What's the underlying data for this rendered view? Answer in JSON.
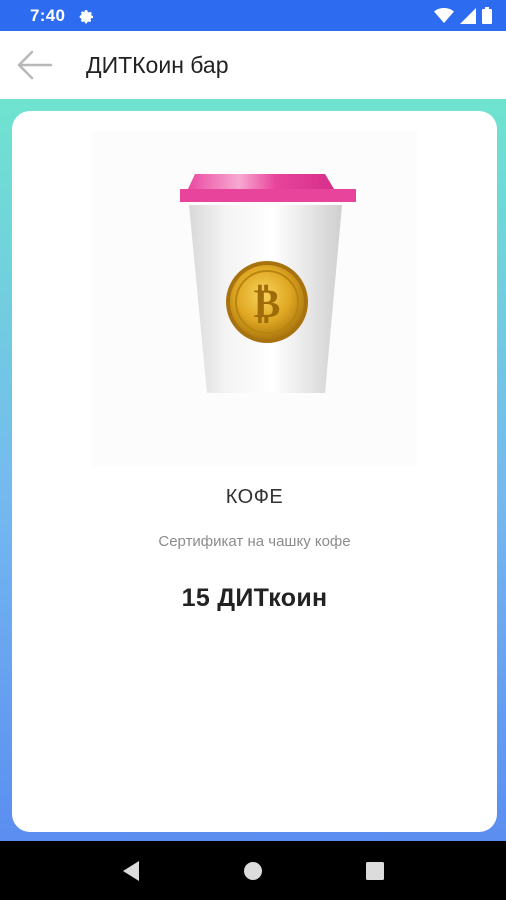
{
  "status_bar": {
    "time": "7:40",
    "icons": [
      "settings-gear-icon",
      "wifi-icon",
      "signal-icon",
      "battery-icon"
    ]
  },
  "app_bar": {
    "title": "ДИТКоин бар",
    "back_icon": "arrow-left-icon"
  },
  "product": {
    "image_icon": "coffee-cup-with-coin",
    "name": "КОФЕ",
    "description": "Сертификат на чашку кофе",
    "price": "15 ДИТкоин"
  },
  "nav_bar": {
    "buttons": [
      "back-triangle-icon",
      "home-circle-icon",
      "recents-square-icon"
    ]
  },
  "colors": {
    "status_bar": "#2d6bf0",
    "gradient_top": "#6fe3cf",
    "gradient_bottom": "#5b8df0",
    "lid_pink": "#e83e9a",
    "coin_gold": "#d9a21a"
  }
}
